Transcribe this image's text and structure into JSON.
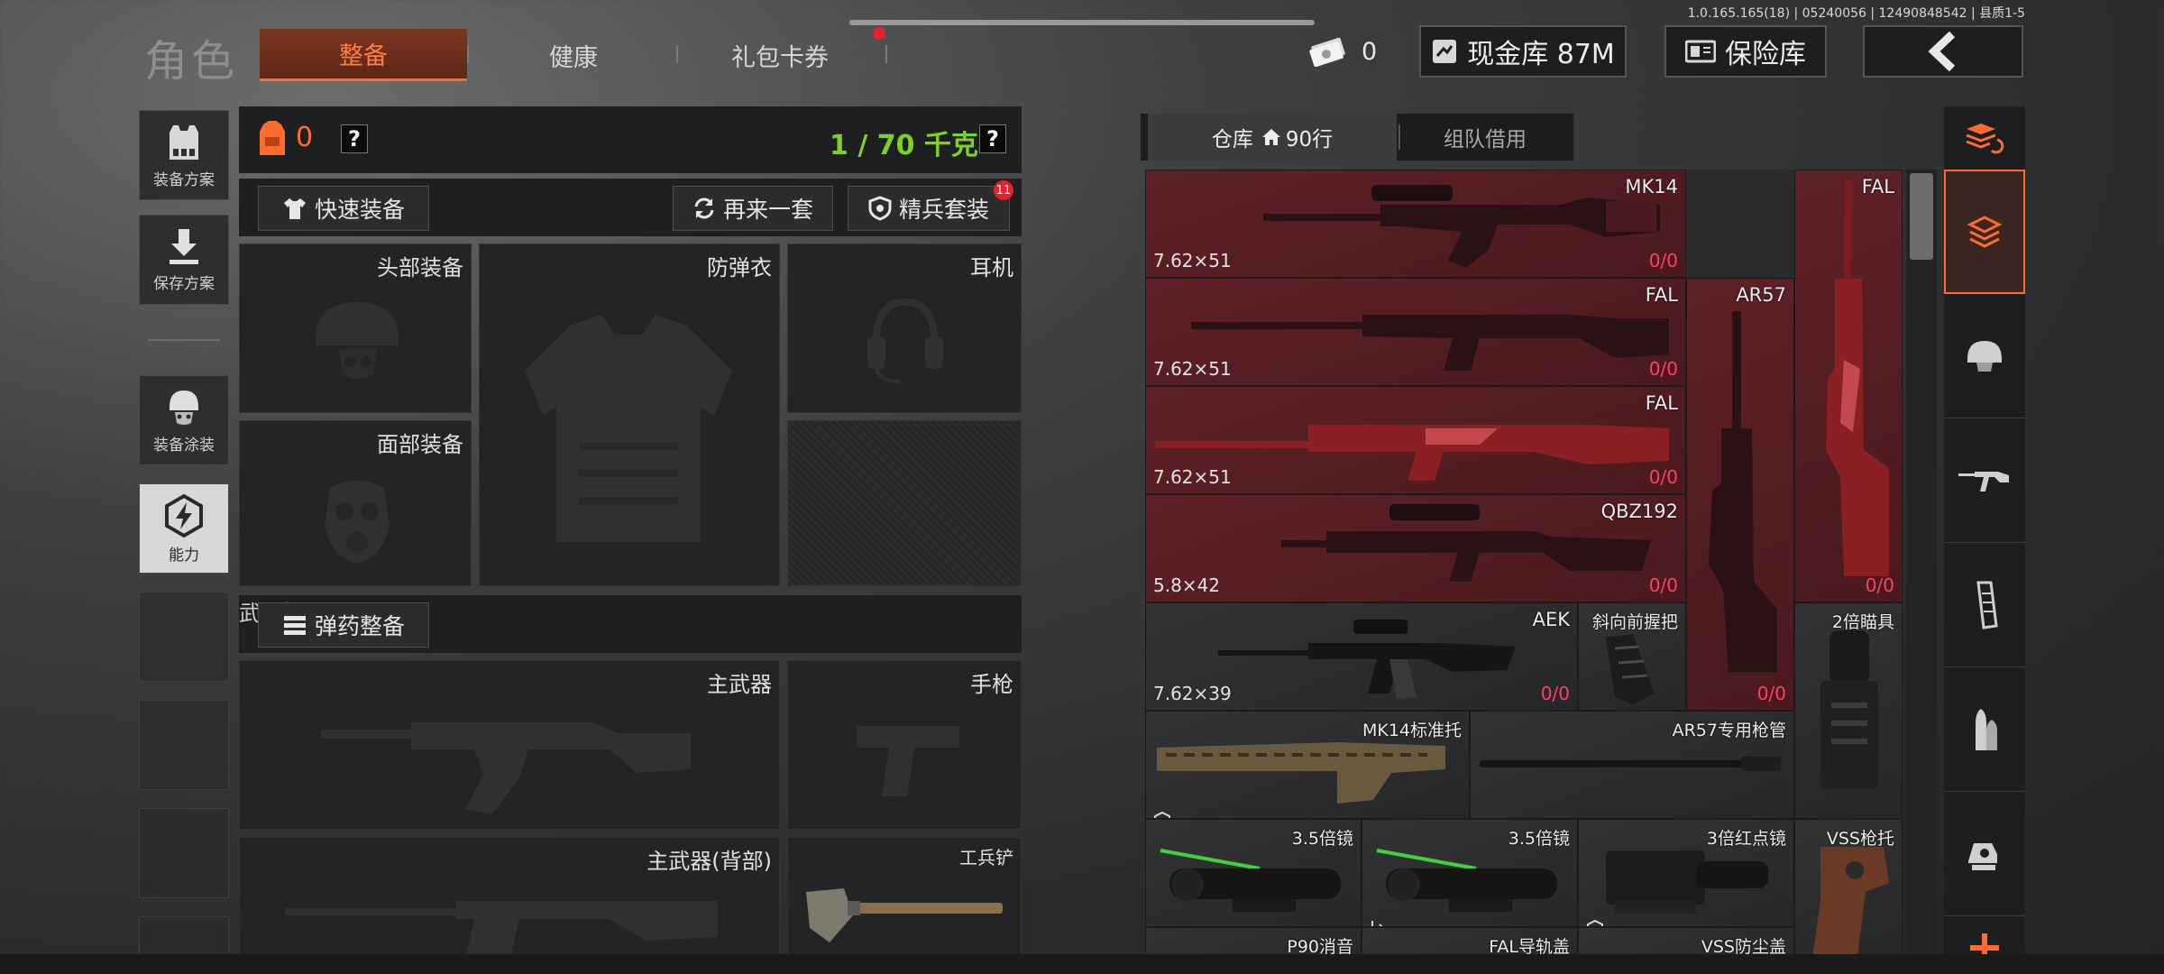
{
  "header": {
    "role_title": "角色",
    "tabs": [
      {
        "label": "整备",
        "active": true
      },
      {
        "label": "健康",
        "active": false
      },
      {
        "label": "礼包卡券",
        "active": false
      }
    ],
    "version": "1.0.165.165(18) | 05240056 | 12490848542 | 县质1-5",
    "cash_count": "0",
    "cash_vault_label": "现金库 87M",
    "safe_label": "保险库",
    "accent_color": "#ff6a2e"
  },
  "left_nav": {
    "items": [
      {
        "label": "装备方案"
      },
      {
        "label": "保存方案"
      },
      {
        "label": "装备涂装"
      },
      {
        "label": "能力"
      }
    ]
  },
  "equipment": {
    "backpack_count": "0",
    "help": "?",
    "weight": "1 / 70 千克",
    "quick_equip": "快速装备",
    "reroll": "再来一套",
    "elite_set": "精兵套装",
    "elite_badge": "11",
    "slots": {
      "head": "头部装备",
      "armor": "防弹衣",
      "earphone": "耳机",
      "face": "面部装备",
      "ammo": "弹药整备",
      "weapon_bar": "武器栏",
      "primary": "主武器",
      "pistol": "手枪",
      "primary_back": "主武器(背部)",
      "shovel": "工兵铲"
    }
  },
  "warehouse": {
    "tab_storage": "仓库",
    "tab_rows": "90行",
    "tab_team": "组队借用",
    "items": [
      {
        "name": "MK14",
        "caliber": "7.62×51",
        "count": "0",
        "max": "0"
      },
      {
        "name": "FAL",
        "caliber": "",
        "count": "0",
        "max": "0"
      },
      {
        "name": "FAL",
        "caliber": "7.62×51",
        "count": "0",
        "max": "0"
      },
      {
        "name": "AR57",
        "caliber": "",
        "count": "0",
        "max": "0"
      },
      {
        "name": "FAL",
        "caliber": "7.62×51",
        "count": "0",
        "max": "0"
      },
      {
        "name": "QBZ192",
        "caliber": "5.8×42",
        "count": "0",
        "max": "0"
      },
      {
        "name": "AEK",
        "caliber": "7.62×39",
        "count": "0",
        "max": "0"
      },
      {
        "name": "斜向前握把"
      },
      {
        "name": "2倍瞄具"
      },
      {
        "name": "MK14标准托"
      },
      {
        "name": "AR57专用枪管"
      },
      {
        "name": "3.5倍镜"
      },
      {
        "name": "3.5倍镜"
      },
      {
        "name": "3倍红点镜"
      },
      {
        "name": "VSS枪托"
      },
      {
        "name": "P90消音"
      },
      {
        "name": "FAL导轨盖"
      },
      {
        "name": "VSS防尘盖"
      }
    ]
  },
  "rail": {
    "icons": [
      "stack-refresh-icon",
      "stack-icon",
      "helmet-icon",
      "rifle-icon",
      "magazine-icon",
      "ammo-icon",
      "scope-icon",
      "plus-icon"
    ]
  }
}
